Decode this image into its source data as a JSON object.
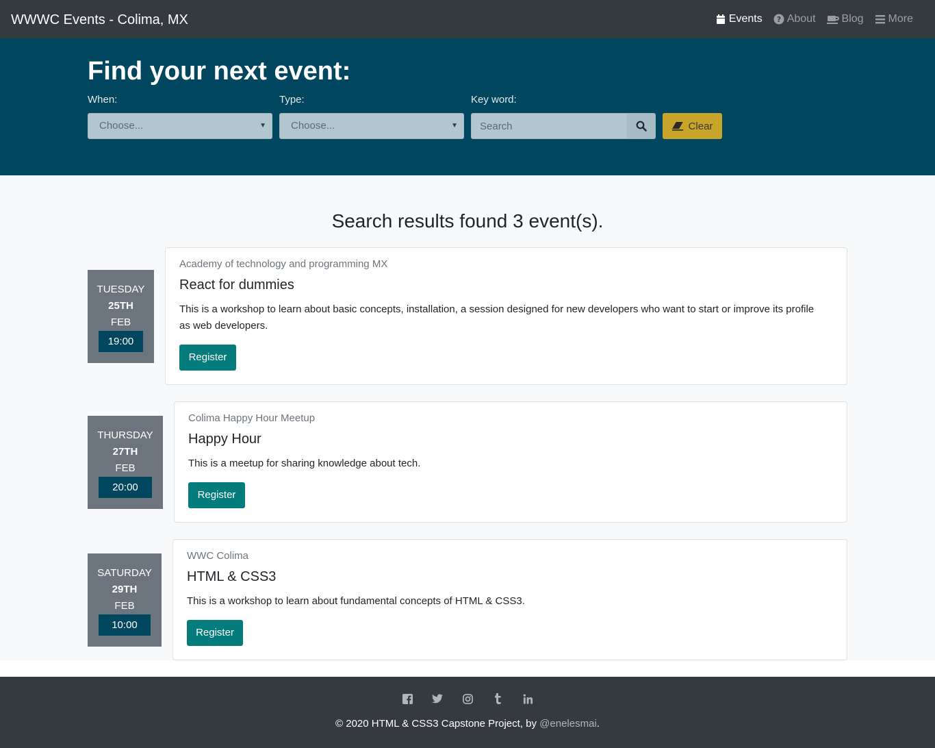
{
  "navbar": {
    "brand": "WWWC Events - Colima, MX",
    "items": [
      {
        "label": "Events",
        "icon": "calendar-icon",
        "active": true
      },
      {
        "label": "About",
        "icon": "question-circle-icon",
        "active": false
      },
      {
        "label": "Blog",
        "icon": "coffee-cup-icon",
        "active": false
      },
      {
        "label": "More",
        "icon": "hamburger-icon",
        "active": false
      }
    ]
  },
  "hero": {
    "title": "Find your next event:",
    "when_label": "When:",
    "when_value": "Choose...",
    "type_label": "Type:",
    "type_value": "Choose...",
    "keyword_label": "Key word:",
    "search_placeholder": "Search",
    "search_icon": "search-icon",
    "clear_label": "Clear",
    "clear_icon": "eraser-icon"
  },
  "results": {
    "title": "Search results found 3 event(s).",
    "events": [
      {
        "weekday": "TUESDAY",
        "day": "25TH",
        "month": "FEB",
        "time": "19:00",
        "organizer": "Academy of technology and programming MX",
        "title": "React for dummies",
        "description": "This is a workshop to learn about basic concepts, installation, a session designed for new developers who want to start or improve its profile as web developers.",
        "button": "Register"
      },
      {
        "weekday": "THURSDAY",
        "day": "27TH",
        "month": "FEB",
        "time": "20:00",
        "organizer": "Colima Happy Hour Meetup",
        "title": "Happy Hour",
        "description": "This is a meetup for sharing knowledge about tech.",
        "button": "Register"
      },
      {
        "weekday": "SATURDAY",
        "day": "29TH",
        "month": "FEB",
        "time": "10:00",
        "organizer": "WWC Colima",
        "title": "HTML & CSS3",
        "description": "This is a workshop to learn about fundamental concepts of HTML & CSS3.",
        "button": "Register"
      }
    ]
  },
  "footer": {
    "social": [
      "facebook-icon",
      "twitter-icon",
      "instagram-icon",
      "tumblr-icon",
      "linkedin-icon"
    ],
    "copyright_text": "© 2020 HTML & CSS3 Capstone Project, by ",
    "author": "@enelesmai",
    "period": "."
  },
  "colors": {
    "navbar": "#343a40",
    "hero": "#01465f",
    "register": "#047c7c",
    "clear": "#c7a52a",
    "date_box": "#6c757d"
  }
}
